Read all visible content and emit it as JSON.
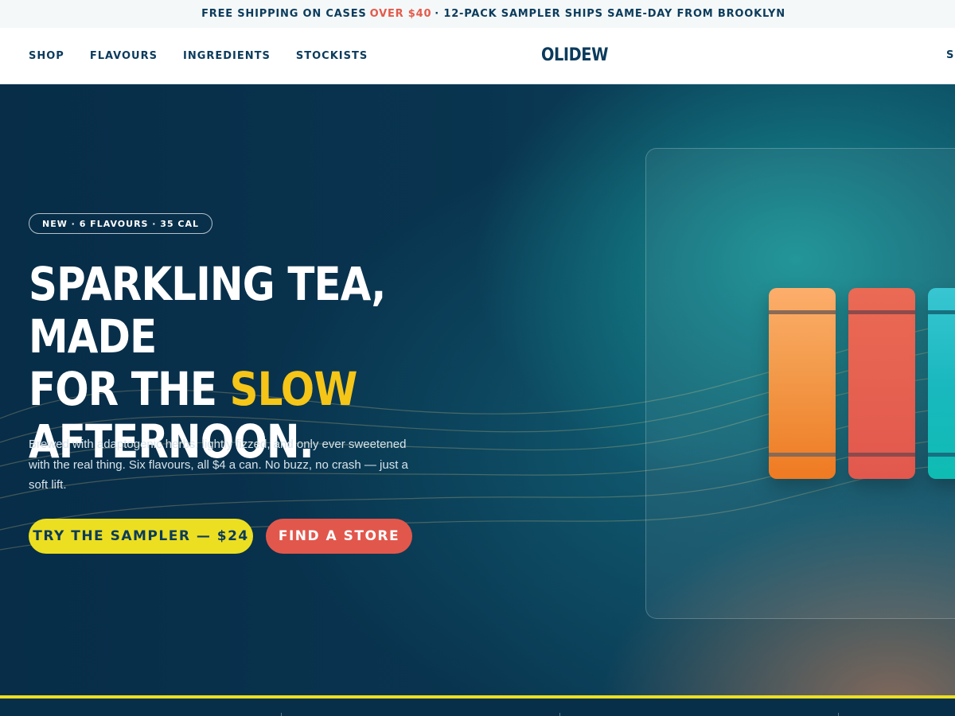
{
  "announcement": {
    "prefix": "FREE SHIPPING ON CASES",
    "highlight": "OVER $40",
    "suffix": "· 12-PACK SAMPLER SHIPS SAME-DAY FROM BROOKLYN",
    "highlight_color": "#e45a4b"
  },
  "nav": {
    "links": [
      {
        "label": "SHOP"
      },
      {
        "label": "FLAVOURS"
      },
      {
        "label": "INGREDIENTS"
      },
      {
        "label": "STOCKISTS"
      }
    ],
    "logo": "OLIDEW",
    "right_link": "S"
  },
  "hero": {
    "badge": "NEW · 6 FLAVOURS · 35 CAL",
    "headline_line1": "SPARKLING TEA, MADE",
    "headline_line2_prefix": "FOR THE",
    "headline_accent": "SLOW",
    "headline_line3": "AFTERNOON.",
    "accent_color": "#f5c518",
    "description": "Brewed with adaptogenic herbs, lightly fizzed, and only ever sweetened with the real thing. Six flavours, all $4 a can. No buzz, no crash — just a soft lift.",
    "primary_cta": "TRY THE SAMPLER — $24",
    "secondary_cta": "FIND A STORE",
    "cans": [
      {
        "flavour_color": "orange"
      },
      {
        "flavour_color": "coral"
      },
      {
        "flavour_color": "teal"
      }
    ]
  },
  "colors": {
    "navy": "#0b3b5c",
    "yellow": "#ecdf21",
    "coral": "#e2574c",
    "background": "#072f4a"
  }
}
